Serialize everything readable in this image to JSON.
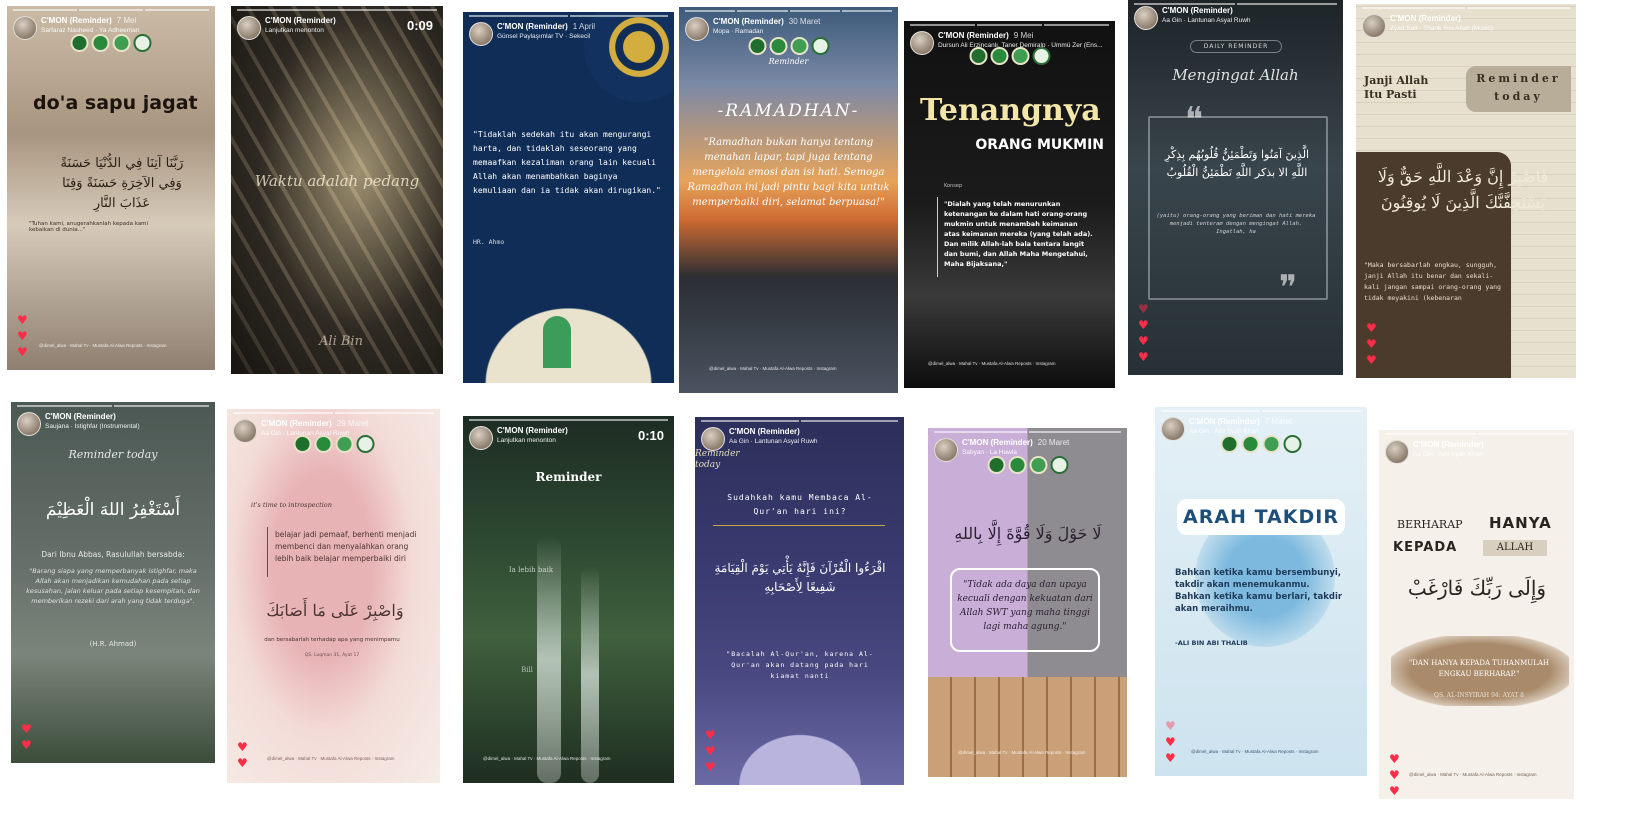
{
  "colors": {
    "heart": "#ff2d4a",
    "badge_green": "#1f6e2e"
  },
  "icons": {
    "heart": "heart-icon",
    "badge": "badge-icon"
  },
  "cards": [
    {
      "account": "C'MON (Reminder)",
      "date": "7 Mei",
      "music": "Sarfaraz Nasheed · Ya Adheeman",
      "title": "do'a sapu jagat",
      "arabic": "رَبَّنَا آتِنَا فِي الدُّنْيَا حَسَنَةً وَفِي الآخِرَةِ حَسَنَةً وَقِنَا عَذَابَ النَّارِ",
      "body": "\"Tuhan kami, anugerahkanlah kepada kami kebaikan di dunia...\"",
      "footer": "@dimel_alwa · Mahal Tv · Mustafa Al-Alwa Reposts · Instagram"
    },
    {
      "account": "C'MON (Reminder)",
      "date": "",
      "music": "Lanjutkan menonton",
      "timer": "0:09",
      "title": "Waktu adalah pedang",
      "signature": "Ali Bin"
    },
    {
      "account": "C'MON (Reminder)",
      "date": "1 April",
      "music": "Günsel Paylaşımlar TV · Sekecil",
      "body": "\"Tidaklah sedekah itu akan mengurangi harta, dan tidaklah seseorang yang memaafkan kezaliman orang lain kecuali Allah akan menambahkan baginya kemuliaan dan ia tidak akan dirugikan.\"",
      "source": "HR. Ahmo"
    },
    {
      "account": "C'MON (Reminder)",
      "date": "30 Maret",
      "music": "Mopa · Ramadan",
      "label": "Reminder",
      "title": "-RAMADHAN-",
      "body": "\"Ramadhan bukan hanya tentang menahan lapar, tapi juga tentang mengelola emosi dan isi hati. Semoga Ramadhan ini jadi pintu bagi kita untuk memperbaiki diri, selamat berpuasa!\"",
      "footer": "@dimel_alwa · Mahal Tv · Mustafa Al-Alwa Reposts · Instagram"
    },
    {
      "account": "C'MON (Reminder)",
      "date": "9 Mei",
      "music": "Dursun Ali Erzincanlı, Taner Demiralp · Ümmü Zer (Ens...",
      "title": "Tenangnya",
      "subtitle": "ORANG MUKMIN",
      "label": "Konsep",
      "body": "\"Dialah yang telah menurunkan ketenangan ke dalam hati orang-orang mukmin untuk menambah keimanan atas keimanan mereka (yang telah ada). Dan milik Allah-lah bala tentara langit dan bumi, dan Allah Maha Mengetahui, Maha Bijaksana,\"",
      "footer": "@dimel_alwa · Mahal Tv · Mustafa Al-Alwa Reposts · Instagram"
    },
    {
      "account": "C'MON (Reminder)",
      "date": "",
      "music": "Aa Gin · Lantunan Asyal Ruwh",
      "label": "DAILY REMINDER",
      "title": "Mengingat Allah",
      "arabic": "الَّذِينَ آمَنُوا وَتَطْمَئِنُّ قُلُوبُهُم بِذِكْرِ اللَّهِ الا بذكر اللَّهِ تَطْمَئِنُّ الْقُلُوبُ",
      "body": "(yaitu) orang-orang yang beriman dan hati mereka menjadi tenteram dengan mengingat Allah. Ingatlah, ha"
    },
    {
      "account": "C'MON (Reminder)",
      "date": "",
      "music": "Zyad Salt · Thank You Allah (Music)",
      "title": "Janji Allah Itu Pasti",
      "subtitle": "Reminder today",
      "arabic": "فَاصْبِرْ إِنَّ وَعْدَ اللَّهِ حَقٌّ وَلَا يَسْتَخِفَّنَّكَ الَّذِينَ لَا يُوقِنُونَ",
      "body": "\"Maka bersabarlah engkau, sungguh, janji Allah itu benar dan sekali-kali jangan sampai orang-orang yang tidak meyakini (kebenaran"
    },
    {
      "account": "C'MON (Reminder)",
      "date": "",
      "music": "Saujana · Istighfar (Instrumental)",
      "title": "Reminder today",
      "arabic": "أَسْتَغْفِرُ اللهَ الْعَظِيْمَ",
      "body": "Dari Ibnu Abbas, Rasulullah bersabda:",
      "quote": "\"Barang siapa yang memperbanyak istighfar, maka Allah akan menjadikan kemudahan pada setiap kesusahan, jalan keluar pada setiap kesempitan, dan memberikan rezeki dari arah yang tidak terduga\".",
      "source": "(H.R. Ahmad)"
    },
    {
      "account": "C'MON (Reminder)",
      "date": "29 Maret",
      "music": "Aa Gin · Lantunan Asyal Ruwh",
      "label": "it's time to introspection",
      "body": "belajar jadi pemaaf, berhenti menjadi membenci dan menyalahkan orang lebih baik belajar memperbaiki diri",
      "arabic": "وَاصْبِرْ عَلَى مَا أَصَابَكَ",
      "subtitle": "dan bersabarlah terhadap apa yang menimpamu",
      "source": "QS. Luqman 31, Ayat 17",
      "footer": "@dimel_alwa · Mahal Tv · Mustafa Al-Alwa Reposts · Instagram"
    },
    {
      "account": "C'MON (Reminder)",
      "date": "",
      "music": "Lanjutkan menonton",
      "timer": "0:10",
      "title": "Reminder",
      "body": "Ia lebih baik",
      "signature": "Bill",
      "footer": "@dimel_alwa · Mahal Tv · Mustafa Al-Alwa Reposts · Instagram"
    },
    {
      "account": "C'MON (Reminder)",
      "date": "",
      "music": "Aa Gin · Lantunan Asyal Ruwh",
      "label": "Reminder today",
      "title": "Sudahkah kamu Membaca Al-Qur'an hari ini?",
      "arabic": "اقْرَءُوا الْقُرْآنَ فَإِنَّهُ يَأْتِي يَوْمَ الْقِيَامَةِ شَفِيعًا لِأَصْحَابِهِ",
      "body": "\"Bacalah Al-Qur'an, karena Al-Qur'an akan datang pada hari kiamat nanti"
    },
    {
      "account": "C'MON (Reminder)",
      "date": "20 Maret",
      "music": "Sabyan · La Hawla",
      "arabic": "لَا حَوْلَ وَلَا قُوَّةَ إِلَّا بِاللهِ",
      "body": "\"Tidak ada daya dan upaya kecuali dengan kekuatan dari Allah SWT yang maha tinggi lagi maha agung.\"",
      "footer": "@dimel_alwa · Mahal Tv · Mustafa Al-Alwa Reposts · Instagram"
    },
    {
      "account": "C'MON (Reminder)",
      "date": "7 Maret",
      "music": "Aa Gin · Aini Syah Khan",
      "title": "ARAH TAKDIR",
      "body": "Bahkan ketika kamu bersembunyi, takdir akan menemukanmu. Bahkan ketika kamu berlari, takdir akan meraihmu.",
      "source": "-ALI BIN ABI THALIB",
      "footer": "@dimel_alwa · Mahal Tv · Mustafa Al-Alwa Reposts · Instagram"
    },
    {
      "account": "C'MON (Reminder)",
      "date": "",
      "music": "Aa Gin · Aini Syah Khan",
      "title": "BERHARAP",
      "subtitle": "HANYA",
      "label": "KEPADA",
      "label2": "ALLAH",
      "arabic": "وَإِلَى رَبِّكَ فَارْغَبْ",
      "body": "\"DAN HANYA KEPADA TUHANMULAH ENGKAU BERHARAP.\"",
      "source": "QS. AL-INSYIRAH 94: AYAT 8",
      "footer": "@dimel_alwa · Mahal Tv · Mustafa Al-Alwa Reposts · Instagram"
    }
  ]
}
